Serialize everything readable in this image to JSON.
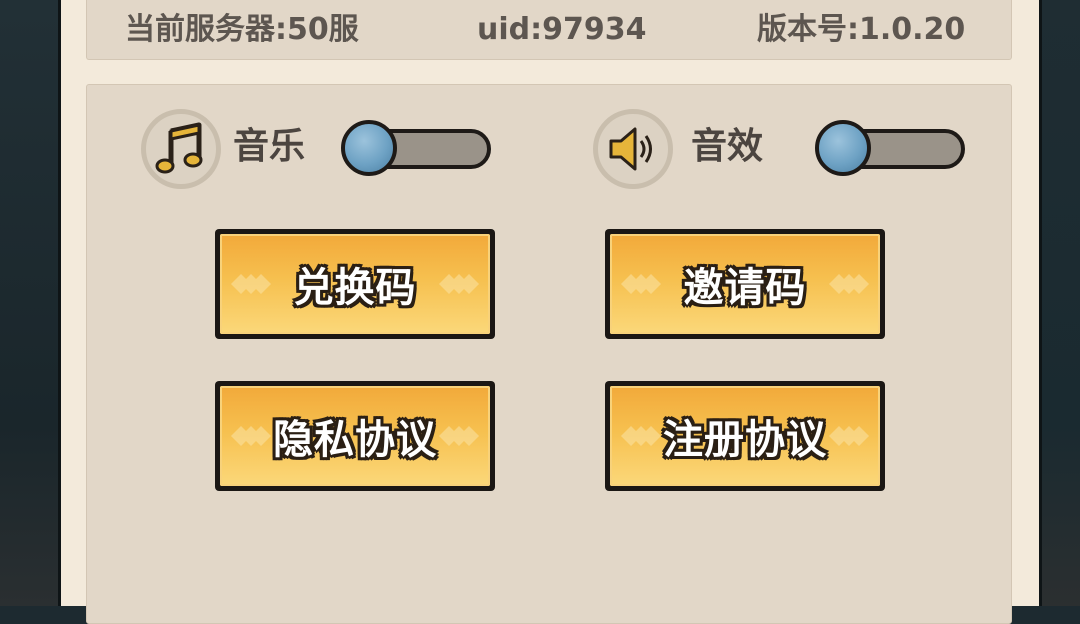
{
  "info_bar": {
    "server": "当前服务器:50服",
    "uid": "uid:97934",
    "version": "版本号:1.0.20"
  },
  "settings": {
    "music": {
      "label": "音乐",
      "icon": "music-note-icon",
      "enabled": false
    },
    "sound": {
      "label": "音效",
      "icon": "speaker-icon",
      "enabled": false
    }
  },
  "buttons": {
    "redeem": "兑换码",
    "invite": "邀请码",
    "privacy": "隐私协议",
    "register": "注册协议"
  },
  "colors": {
    "panel_bg": "#f3eadb",
    "box_bg": "#e2d7c8",
    "button_orange": "#f6c04f",
    "icon_gold": "#e6b53a",
    "toggle_knob": "#6ea2c4"
  }
}
